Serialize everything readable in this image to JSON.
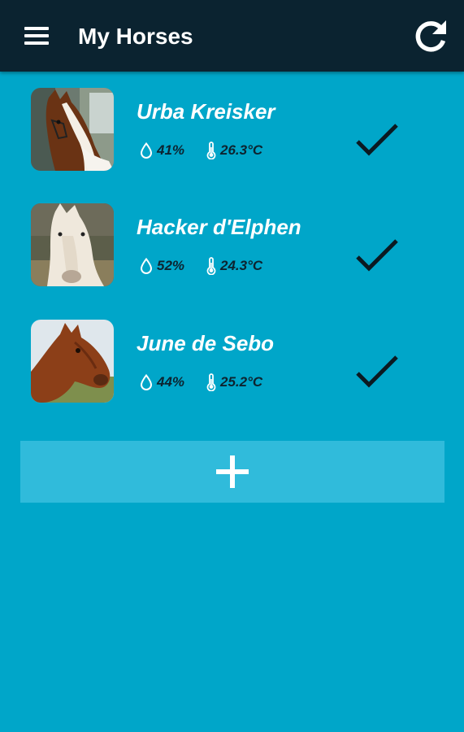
{
  "appbar": {
    "title": "My Horses",
    "menu_icon": "hamburger-menu-icon",
    "refresh_icon": "refresh-icon"
  },
  "horses": [
    {
      "name": "Urba Kreisker",
      "humidity": "41%",
      "temperature": "26.3°C",
      "status_icon": "checkmark-icon",
      "photo": "brown-white-horse-photo"
    },
    {
      "name": "Hacker d'Elphen",
      "humidity": "52%",
      "temperature": "24.3°C",
      "status_icon": "checkmark-icon",
      "photo": "white-horse-photo"
    },
    {
      "name": "June de Sebo",
      "humidity": "44%",
      "temperature": "25.2°C",
      "status_icon": "checkmark-icon",
      "photo": "bay-horse-photo"
    }
  ],
  "add_button": {
    "icon": "plus-icon"
  },
  "colors": {
    "background": "#00a6c9",
    "appbar": "#0b2330",
    "add_button": "#30bbdb",
    "text": "#ffffff",
    "stat_text": "#0d2430"
  }
}
